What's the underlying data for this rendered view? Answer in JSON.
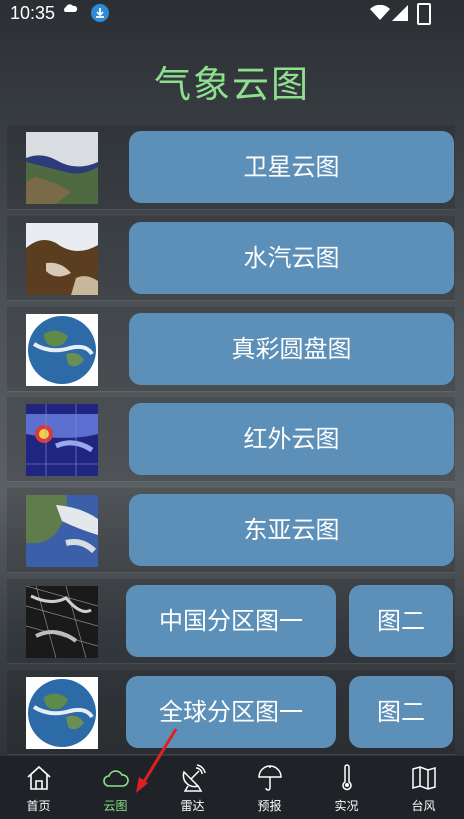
{
  "status_bar": {
    "time": "10:35"
  },
  "page_title": "气象云图",
  "rows": [
    {
      "buttons": [
        "卫星云图"
      ],
      "thumb": "satellite"
    },
    {
      "buttons": [
        "水汽云图"
      ],
      "thumb": "water-vapor"
    },
    {
      "buttons": [
        "真彩圆盘图"
      ],
      "thumb": "globe"
    },
    {
      "buttons": [
        "红外云图"
      ],
      "thumb": "infrared"
    },
    {
      "buttons": [
        "东亚云图"
      ],
      "thumb": "east-asia"
    },
    {
      "buttons": [
        "中国分区图一",
        "图二"
      ],
      "thumb": "china-grid"
    },
    {
      "buttons": [
        "全球分区图一",
        "图二"
      ],
      "thumb": "globe"
    }
  ],
  "tabs": [
    {
      "label": "首页",
      "icon": "home-icon"
    },
    {
      "label": "云图",
      "icon": "cloud-icon",
      "active": true
    },
    {
      "label": "雷达",
      "icon": "radar-icon"
    },
    {
      "label": "预报",
      "icon": "umbrella-icon"
    },
    {
      "label": "实况",
      "icon": "thermometer-icon"
    },
    {
      "label": "台风",
      "icon": "map-icon"
    }
  ],
  "colors": {
    "accent": "#8fe08e",
    "button": "#5d90b8",
    "annotation_arrow": "#e02020"
  }
}
